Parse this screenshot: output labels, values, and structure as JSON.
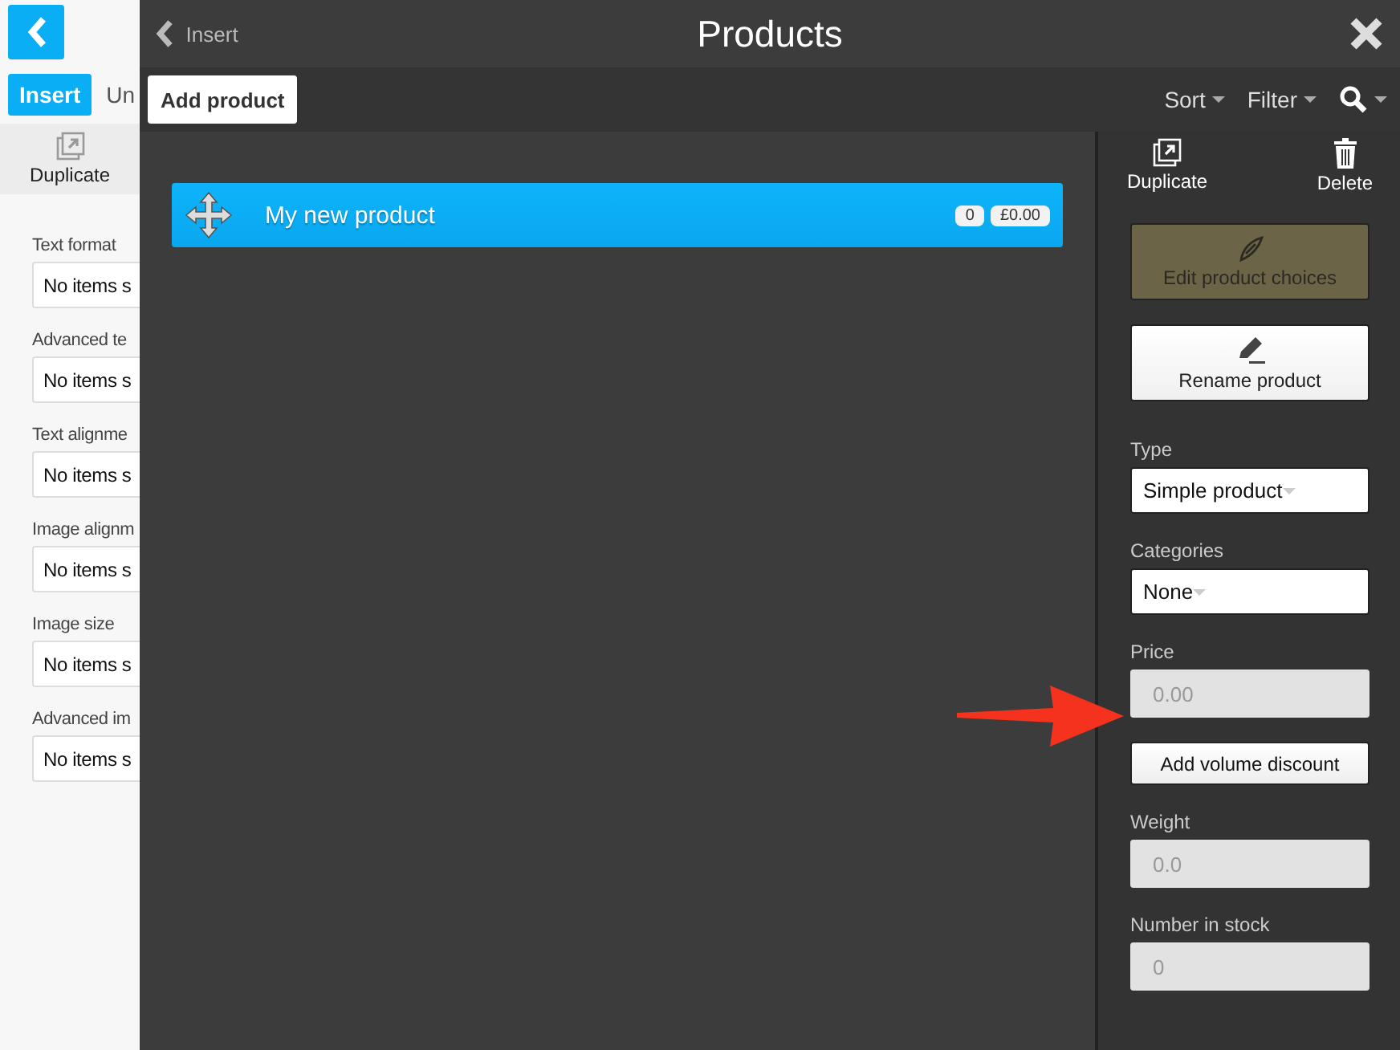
{
  "editor": {
    "tabs": [
      {
        "label": "Insert",
        "selected": true
      },
      {
        "label": "Un",
        "selected": false
      }
    ],
    "duplicate_label": "Duplicate",
    "fields": [
      {
        "label": "Text format",
        "value": "No items s"
      },
      {
        "label": "Advanced te",
        "value": "No items s"
      },
      {
        "label": "Text alignme",
        "value": "No items s"
      },
      {
        "label": "Image alignm",
        "value": "No items s"
      },
      {
        "label": "Image size",
        "value": "No items s"
      },
      {
        "label": "Advanced im",
        "value": "No items s"
      }
    ]
  },
  "dialog": {
    "back_label": "Insert",
    "title": "Products",
    "add_button": "Add product",
    "toolbar": [
      "Sort",
      "Filter"
    ],
    "products": [
      {
        "name": "My new product",
        "count": "0",
        "price": "£0.00",
        "selected": true
      }
    ],
    "sidebar": {
      "actions": [
        {
          "kind": "duplicate",
          "label": "Duplicate"
        },
        {
          "kind": "delete",
          "label": "Delete"
        }
      ],
      "items": [
        {
          "kind": "button",
          "label": "Edit product choices",
          "disabled": true
        },
        {
          "kind": "button",
          "label": "Rename product",
          "disabled": false
        },
        {
          "kind": "select",
          "label": "Type",
          "value": "Simple product"
        },
        {
          "kind": "select",
          "label": "Categories",
          "value": "None"
        },
        {
          "kind": "input",
          "label": "Price",
          "placeholder": "0.00"
        },
        {
          "kind": "small_button",
          "label": "Add volume discount"
        },
        {
          "kind": "input",
          "label": "Weight",
          "placeholder": "0.0"
        },
        {
          "kind": "input",
          "label": "Number in stock",
          "placeholder": "0"
        }
      ]
    }
  }
}
